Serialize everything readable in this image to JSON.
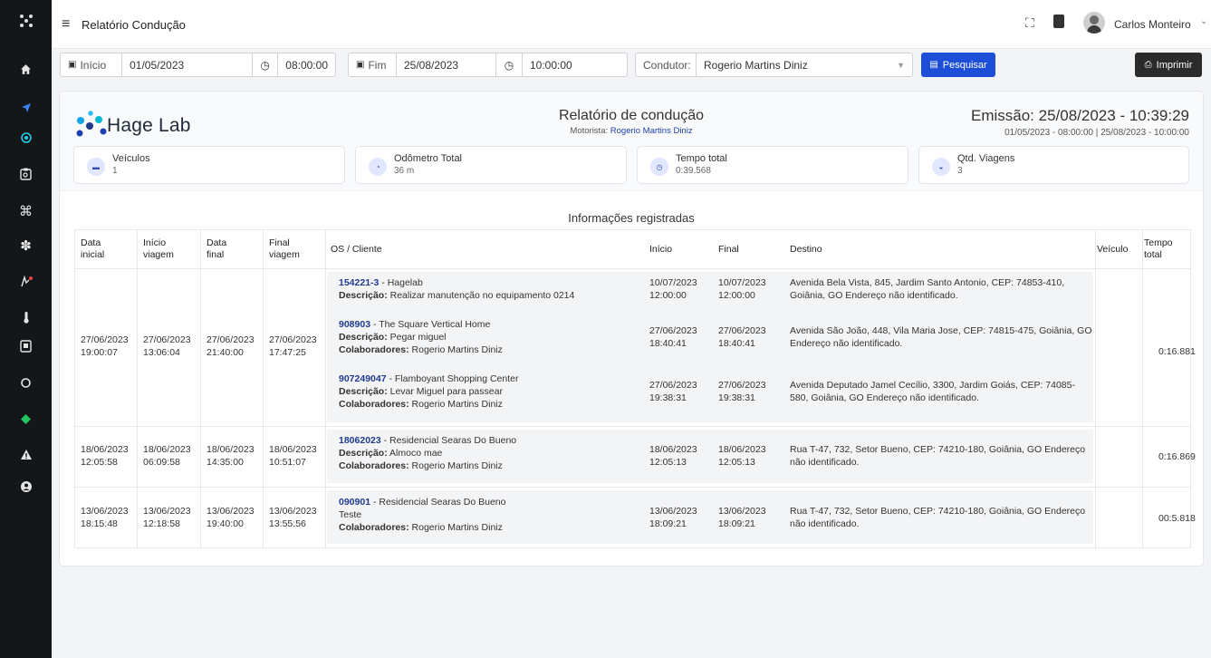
{
  "topbar": {
    "title": "Relatório Condução",
    "user_name": "Carlos Monteiro",
    "menu_glyph": "≡",
    "expand_glyph": "⛶",
    "chevron_glyph": "⌄"
  },
  "filters": {
    "start_label": "Início",
    "start_date": "01/05/2023",
    "start_time": "08:00:00",
    "end_label": "Fim",
    "end_date": "25/08/2023",
    "end_time": "10:00:00",
    "driver_label": "Condutor:",
    "driver_value": "Rogerio Martins Diniz",
    "search_button": "Pesquisar",
    "print_button": "Imprimir"
  },
  "report": {
    "logo_text": "Hage Lab",
    "title": "Relatório de condução",
    "driver_prefix": "Motorista:",
    "driver_name": "Rogerio Martins Diniz",
    "emission": "Emissão: 25/08/2023 - 10:39:29",
    "range": "01/05/2023 - 08:00:00 | 25/08/2023 - 10:00:00",
    "stats": [
      {
        "label": "Veículos",
        "value": "1",
        "icon": "car-icon"
      },
      {
        "label": "Odômetro Total",
        "value": "36 m",
        "icon": "gauge-icon"
      },
      {
        "label": "Tempo total",
        "value": "0:39.568",
        "icon": "clock-icon"
      },
      {
        "label": "Qtd. Viagens",
        "value": "3",
        "icon": "trip-icon"
      }
    ],
    "section_title": "Informações registradas"
  },
  "table": {
    "headers": {
      "data_inicial": [
        "Data",
        "inicial"
      ],
      "inicio_viagem": [
        "Início",
        "viagem"
      ],
      "data_final": [
        "Data",
        "final"
      ],
      "final_viagem": [
        "Final",
        "viagem"
      ],
      "os_cliente": "OS / Cliente",
      "inicio": "Início",
      "final": "Final",
      "destino": "Destino",
      "veiculo": "Veículo",
      "tempo_total": [
        "Tempo",
        "total"
      ]
    },
    "groups": [
      {
        "data_inicial": [
          "27/06/2023",
          "19:00:07"
        ],
        "inicio_viagem": [
          "27/06/2023",
          "13:06:04"
        ],
        "data_final": [
          "27/06/2023",
          "21:40:00"
        ],
        "final_viagem": [
          "27/06/2023",
          "17:47:25"
        ],
        "tempo_total": "0:16.881",
        "items": [
          {
            "code": "154221-3",
            "client": " - Hagelab",
            "line2_label": "Descrição:",
            "line2_value": " Realizar manutenção no equipamento 0214",
            "line3_label": "",
            "line3_value": "",
            "inicio": [
              "10/07/2023",
              "12:00:00"
            ],
            "final": [
              "10/07/2023",
              "12:00:00"
            ],
            "destino": [
              "Avenida Bela Vista, 845, Jardim Santo Antonio, CEP: 74853-410,",
              "Goiânia, GO Endereço não identificado."
            ]
          },
          {
            "code": "908903",
            "client": " - The Square Vertical Home",
            "line2_label": "Descrição:",
            "line2_value": " Pegar miguel",
            "line3_label": "Colaboradores:",
            "line3_value": " Rogerio Martins Diniz",
            "inicio": [
              "27/06/2023",
              "18:40:41"
            ],
            "final": [
              "27/06/2023",
              "18:40:41"
            ],
            "destino": [
              "Avenida São João, 448, Vila Maria Jose, CEP: 74815-475, Goiânia, GO",
              "Endereço não identificado."
            ]
          },
          {
            "code": "907249047",
            "client": " - Flamboyant Shopping Center",
            "line2_label": "Descrição:",
            "line2_value": " Levar Miguel para passear",
            "line3_label": "Colaboradores:",
            "line3_value": " Rogerio Martins Diniz",
            "inicio": [
              "27/06/2023",
              "19:38:31"
            ],
            "final": [
              "27/06/2023",
              "19:38:31"
            ],
            "destino": [
              "Avenida Deputado Jamel Cecílio, 3300, Jardim Goiás, CEP: 74085-",
              "580, Goiânia, GO Endereço não identificado."
            ]
          }
        ]
      },
      {
        "data_inicial": [
          "18/06/2023",
          "12:05:58"
        ],
        "inicio_viagem": [
          "18/06/2023",
          "06:09:58"
        ],
        "data_final": [
          "18/06/2023",
          "14:35:00"
        ],
        "final_viagem": [
          "18/06/2023",
          "10:51:07"
        ],
        "tempo_total": "0:16.869",
        "items": [
          {
            "code": "18062023",
            "client": " - Residencial Searas Do Bueno",
            "line2_label": "Descrição:",
            "line2_value": " Almoco mae",
            "line3_label": "Colaboradores:",
            "line3_value": " Rogerio Martins Diniz",
            "inicio": [
              "18/06/2023",
              "12:05:13"
            ],
            "final": [
              "18/06/2023",
              "12:05:13"
            ],
            "destino": [
              "Rua T-47, 732, Setor Bueno, CEP: 74210-180, Goiânia, GO Endereço",
              "não identificado."
            ]
          }
        ]
      },
      {
        "data_inicial": [
          "13/06/2023",
          "18:15:48"
        ],
        "inicio_viagem": [
          "13/06/2023",
          "12:18:58"
        ],
        "data_final": [
          "13/06/2023",
          "19:40:00"
        ],
        "final_viagem": [
          "13/06/2023",
          "13:55:56"
        ],
        "tempo_total": "00:5.818",
        "items": [
          {
            "code": "090901",
            "client": " - Residencial Searas Do Bueno",
            "line2_label": "",
            "line2_value": "Teste",
            "line3_label": "Colaboradores:",
            "line3_value": " Rogerio Martins Diniz",
            "inicio": [
              "13/06/2023",
              "18:09:21"
            ],
            "final": [
              "13/06/2023",
              "18:09:21"
            ],
            "destino": [
              "Rua T-47, 732, Setor Bueno, CEP: 74210-180, Goiânia, GO Endereço",
              "não identificado."
            ]
          }
        ]
      }
    ]
  },
  "colors": {
    "sidebar": "#14171a",
    "accent": "#1d4ed8",
    "link": "#1e3a8a",
    "sidebar_blue": "#3b82f6",
    "sidebar_cyan": "#22d3ee",
    "sidebar_green": "#22c55e"
  }
}
